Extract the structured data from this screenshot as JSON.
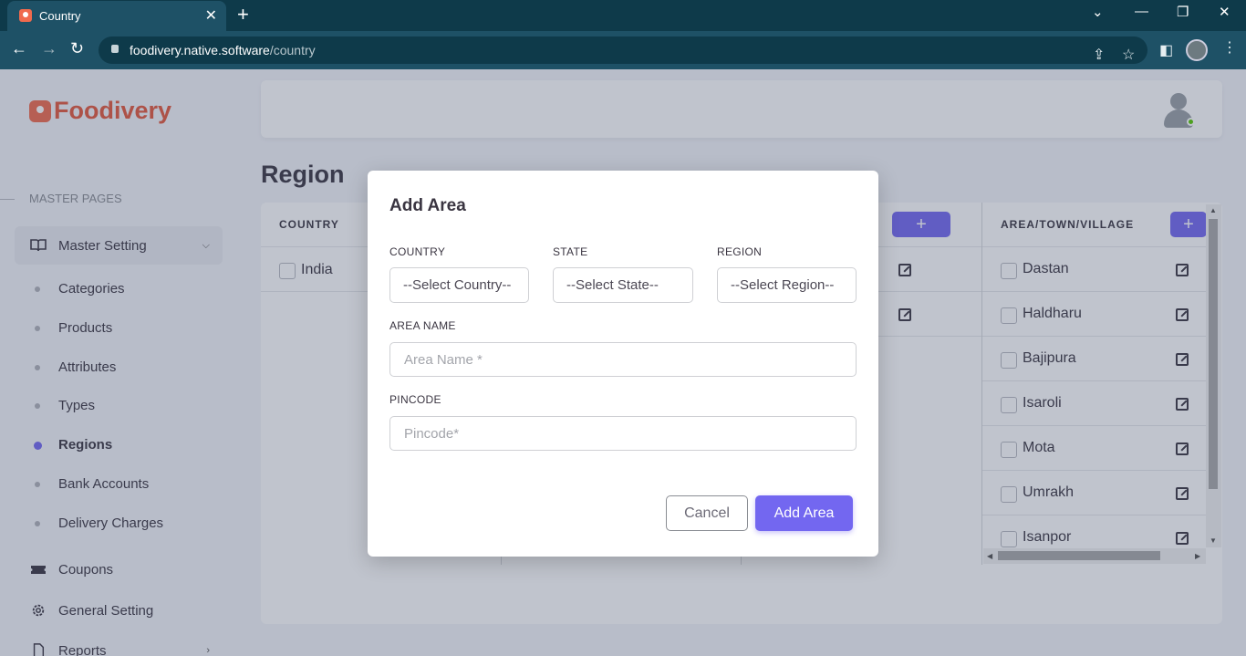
{
  "browser": {
    "tab_title": "Country",
    "url_host": "foodivery.native.software",
    "url_path": "/country"
  },
  "sidebar": {
    "brand": "Foodivery",
    "section_label": "MASTER PAGES",
    "group_label": "Master Setting",
    "sub_items": [
      "Categories",
      "Products",
      "Attributes",
      "Types",
      "Regions",
      "Bank Accounts",
      "Delivery Charges"
    ],
    "active_sub_item": "Regions",
    "bottom_items": [
      "Coupons",
      "General Setting",
      "Reports"
    ]
  },
  "page": {
    "title": "Region"
  },
  "table": {
    "country_header": "COUNTRY",
    "country_rows": [
      "India"
    ],
    "area_header": "AREA/TOWN/VILLAGE",
    "area_rows": [
      "Dastan",
      "Haldharu",
      "Bajipura",
      "Isaroli",
      "Mota",
      "Umrakh",
      "Isanpor"
    ]
  },
  "modal": {
    "title": "Add Area",
    "country_label": "COUNTRY",
    "country_value": "--Select Country--",
    "state_label": "STATE",
    "state_value": "--Select State--",
    "region_label": "REGION",
    "region_value": "--Select Region--",
    "area_name_label": "AREA NAME",
    "area_name_placeholder": "Area Name *",
    "pincode_label": "PINCODE",
    "pincode_placeholder": "Pincode*",
    "cancel_label": "Cancel",
    "submit_label": "Add Area"
  },
  "colors": {
    "primary": "#7367f0",
    "brand": "#e4583c",
    "online_status": "#56ca00"
  }
}
